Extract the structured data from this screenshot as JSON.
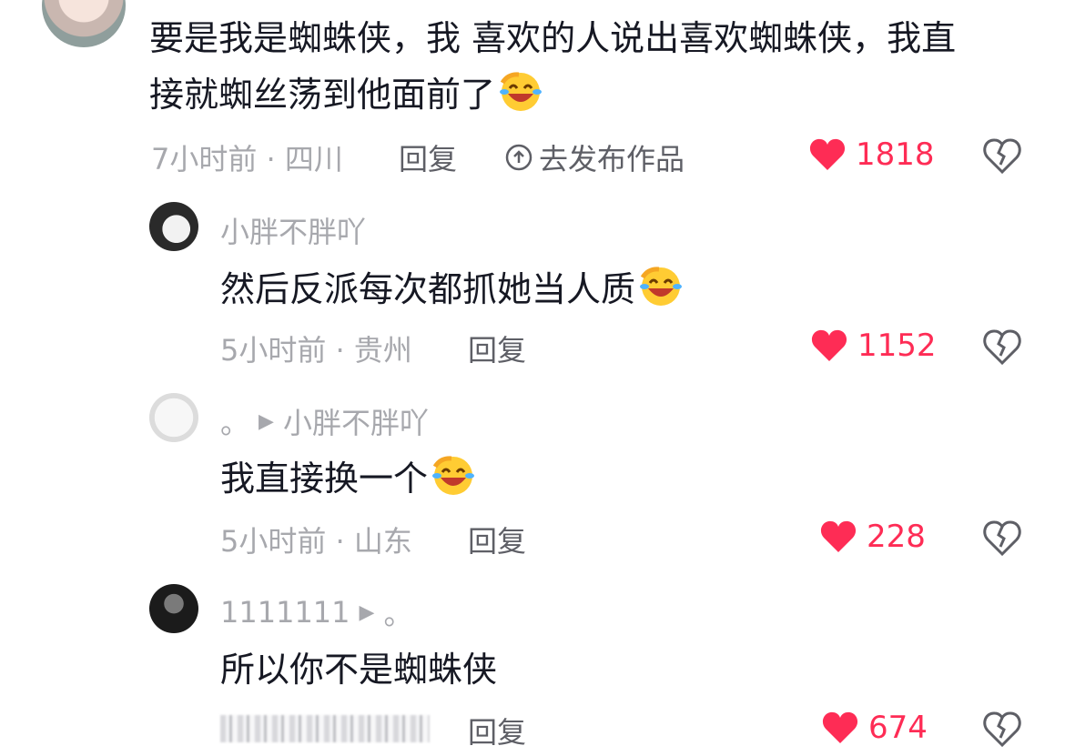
{
  "comments": [
    {
      "text_line1": "要是我是蜘蛛侠，我 喜欢的人说出喜欢蜘蛛侠，我直",
      "text_line2": "接就蜘丝荡到他面前了",
      "meta": "7小时前 · 四川",
      "reply": "回复",
      "publish": "去发布作品",
      "likes": "1818"
    },
    {
      "user": "小胖不胖吖",
      "text": "然后反派每次都抓她当人质",
      "meta": "5小时前 · 贵州",
      "reply": "回复",
      "likes": "1152"
    },
    {
      "user": "。",
      "reply_to": "小胖不胖吖",
      "text": "我直接换一个",
      "meta": "5小时前 · 山东",
      "reply": "回复",
      "likes": "228"
    },
    {
      "user": "1111111",
      "reply_to": "。",
      "text": "所以你不是蜘蛛侠",
      "reply": "回复",
      "likes": "674"
    }
  ],
  "colors": {
    "like": "#fe2c55",
    "meta": "#a7a8ad",
    "text": "#161823"
  },
  "icons": [
    "heart-icon",
    "broken-heart-icon",
    "laughing-crying-emoji",
    "play-arrow-icon",
    "upload-circle-icon"
  ]
}
